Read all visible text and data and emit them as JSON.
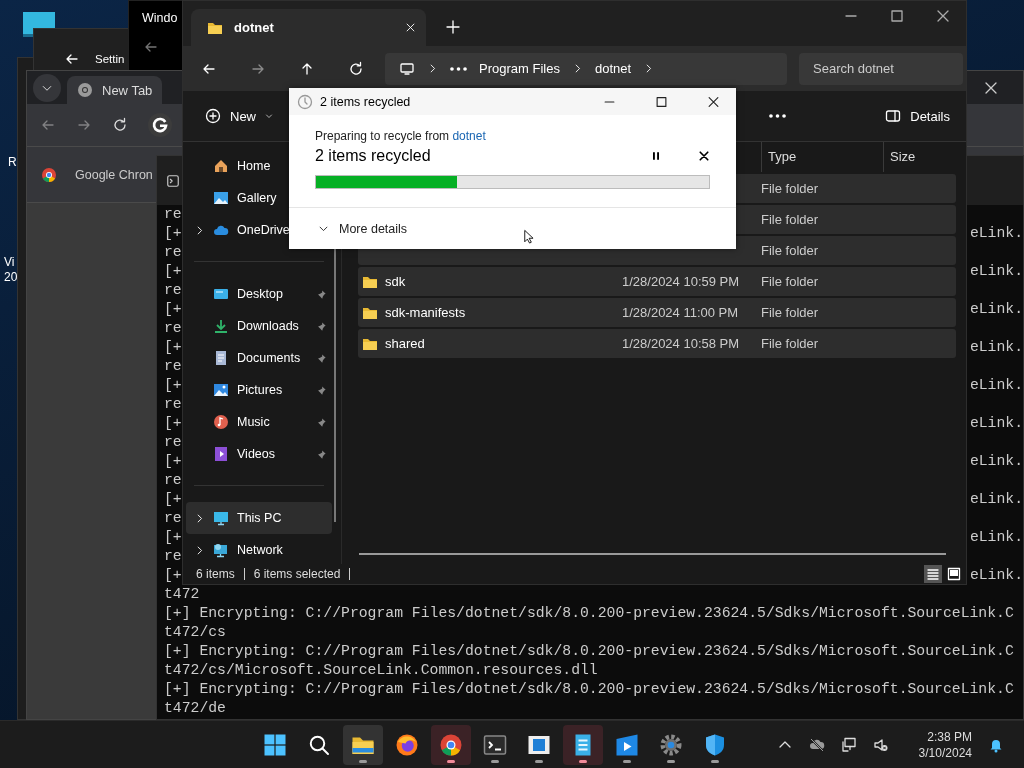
{
  "desktop": {
    "icon_labels": [
      "R",
      "Vi",
      "20"
    ]
  },
  "settings_window": {
    "title": "Settin"
  },
  "background_window": {
    "title": "Windo"
  },
  "browser": {
    "tabs": [
      {
        "label": "New Tab",
        "selected": true
      }
    ],
    "bookmarks": [
      "Google Chron"
    ]
  },
  "terminal": {
    "lines": [
      {
        "left": "re"
      },
      {
        "left": "[+",
        "right": "eLink."
      },
      {
        "left": "re"
      },
      {
        "left": "[+",
        "right": "eLink."
      },
      {
        "left": "re"
      },
      {
        "left": "[+",
        "right": "eLink."
      },
      {
        "left": "re"
      },
      {
        "left": "[+",
        "right": "eLink."
      },
      {
        "left": "re"
      },
      {
        "left": "[+",
        "right": "eLink."
      },
      {
        "left": "re"
      },
      {
        "left": "[+",
        "right": "eLink."
      },
      {
        "left": "re"
      },
      {
        "left": "[+",
        "right": "eLink."
      },
      {
        "left": "re"
      },
      {
        "left": "[+",
        "right": "eLink."
      },
      {
        "left": "re"
      },
      {
        "left": "[+",
        "right": "eLink."
      },
      {
        "left": "re"
      },
      {
        "left": "[+",
        "right": "eLink."
      },
      {
        "text": "t472"
      },
      {
        "text": "[+] Encrypting: C://Program Files/dotnet/sdk/8.0.200-preview.23624.5/Sdks/Microsoft.SourceLink.C"
      },
      {
        "text": "t472/cs"
      },
      {
        "text": "[+] Encrypting: C://Program Files/dotnet/sdk/8.0.200-preview.23624.5/Sdks/Microsoft.SourceLink.C"
      },
      {
        "text": "t472/cs/Microsoft.SourceLink.Common.resources.dll"
      },
      {
        "text": "[+] Encrypting: C://Program Files/dotnet/sdk/8.0.200-preview.23624.5/Sdks/Microsoft.SourceLink.C"
      },
      {
        "text": "t472/de"
      }
    ]
  },
  "explorer": {
    "tab": "dotnet",
    "breadcrumb": [
      "Program Files",
      "dotnet"
    ],
    "search": {
      "placeholder": "Search dotnet"
    },
    "toolbar": {
      "new": "New",
      "details": "Details"
    },
    "sidebar": {
      "groups": [
        [
          {
            "label": "Home",
            "kind": "home",
            "selected": false
          },
          {
            "label": "Gallery",
            "kind": "gallery",
            "selected": false
          },
          {
            "label": "OneDrive",
            "kind": "cloud",
            "expanded": false,
            "selected": false
          }
        ],
        [
          {
            "label": "Desktop",
            "kind": "desktop",
            "pinned": true,
            "selected": false
          },
          {
            "label": "Downloads",
            "kind": "downloads",
            "pinned": true,
            "selected": false
          },
          {
            "label": "Documents",
            "kind": "documents",
            "pinned": true,
            "selected": false
          },
          {
            "label": "Pictures",
            "kind": "pictures",
            "pinned": true,
            "selected": false
          },
          {
            "label": "Music",
            "kind": "music",
            "pinned": true,
            "selected": false
          },
          {
            "label": "Videos",
            "kind": "videos",
            "pinned": true,
            "selected": false
          }
        ],
        [
          {
            "label": "This PC",
            "kind": "pc",
            "expanded": false,
            "selected": true
          },
          {
            "label": "Network",
            "kind": "network",
            "expanded": false,
            "selected": false
          }
        ]
      ]
    },
    "columns": [
      "Type",
      "Size"
    ],
    "rows": [
      {
        "type": "File folder",
        "selected": true
      },
      {
        "type": "File folder",
        "selected": true
      },
      {
        "type": "File folder",
        "selected": true
      },
      {
        "name": "sdk",
        "date": "1/28/2024 10:59 PM",
        "type": "File folder",
        "selected": true
      },
      {
        "name": "sdk-manifests",
        "date": "1/28/2024 11:00 PM",
        "type": "File folder",
        "selected": true
      },
      {
        "name": "shared",
        "date": "1/28/2024 10:58 PM",
        "type": "File folder",
        "selected": true
      }
    ],
    "status": {
      "count": "6 items",
      "selection": "6 items selected"
    },
    "views": [
      {
        "kind": "details",
        "selected": true
      },
      {
        "kind": "tiles",
        "selected": false
      }
    ]
  },
  "dialog": {
    "title": "2 items recycled",
    "message": "Preparing to recycle from ",
    "source": "dotnet",
    "heading": "2 items recycled",
    "progress": {
      "level": 0.36
    },
    "toggle": "More details"
  },
  "taskbar": {
    "apps": [
      {
        "kind": "start",
        "running": false,
        "active": false,
        "attention": false
      },
      {
        "kind": "search",
        "running": false,
        "active": false,
        "attention": false
      },
      {
        "kind": "explorer",
        "running": true,
        "active": true,
        "attention": false
      },
      {
        "kind": "firefox",
        "running": false,
        "active": false,
        "attention": false
      },
      {
        "kind": "chrome",
        "running": true,
        "active": false,
        "attention": true
      },
      {
        "kind": "terminal",
        "running": true,
        "active": false,
        "attention": false
      },
      {
        "kind": "window",
        "running": true,
        "active": false,
        "attention": false
      },
      {
        "kind": "notepad",
        "running": true,
        "active": false,
        "attention": true
      },
      {
        "kind": "media",
        "running": true,
        "active": false,
        "attention": false
      },
      {
        "kind": "settings",
        "running": true,
        "active": false,
        "attention": false
      },
      {
        "kind": "shield",
        "running": true,
        "active": false,
        "attention": false
      }
    ],
    "time": "2:38 PM",
    "date": "3/10/2024"
  }
}
